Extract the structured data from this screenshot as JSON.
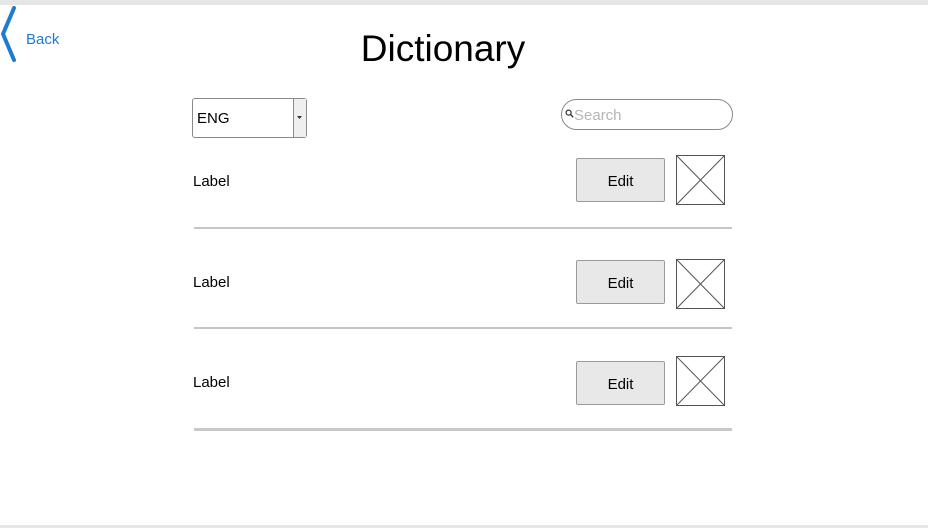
{
  "header": {
    "back_label": "Back",
    "title": "Dictionary"
  },
  "language_select": {
    "selected": "ENG"
  },
  "search": {
    "placeholder": "Search",
    "value": ""
  },
  "rows": [
    {
      "label": "Label",
      "edit_label": "Edit"
    },
    {
      "label": "Label",
      "edit_label": "Edit"
    },
    {
      "label": "Label",
      "edit_label": "Edit"
    }
  ],
  "colors": {
    "link": "#1f7ad3",
    "button_bg": "#e8e8e8",
    "divider": "#c6c6c6"
  },
  "icons": {
    "back": "chevron-left-icon",
    "dropdown": "caret-down-icon",
    "search": "magnifier-icon",
    "image": "image-placeholder-icon"
  }
}
